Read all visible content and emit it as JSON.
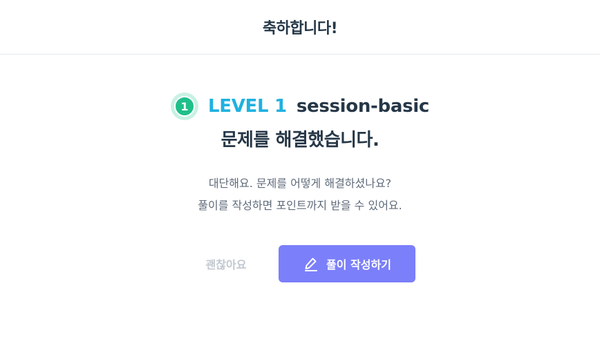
{
  "header": {
    "title": "축하합니다!"
  },
  "headline": {
    "level_number": "1",
    "level_label": "LEVEL 1",
    "problem_name": "session-basic",
    "solved_text": "문제를 해결했습니다."
  },
  "message": {
    "line1": "대단해요. 문제를 어떻게 해결하셨나요?",
    "line2": "풀이를 작성하면 포인트까지 받을 수 있어요."
  },
  "actions": {
    "dismiss_label": "괜찮아요",
    "write_label": "풀이 작성하기",
    "write_icon": "pencil-icon"
  },
  "colors": {
    "accent_level": "#1fb1e0",
    "badge": "#1fbf8a",
    "primary_button": "#7b7ffa"
  }
}
